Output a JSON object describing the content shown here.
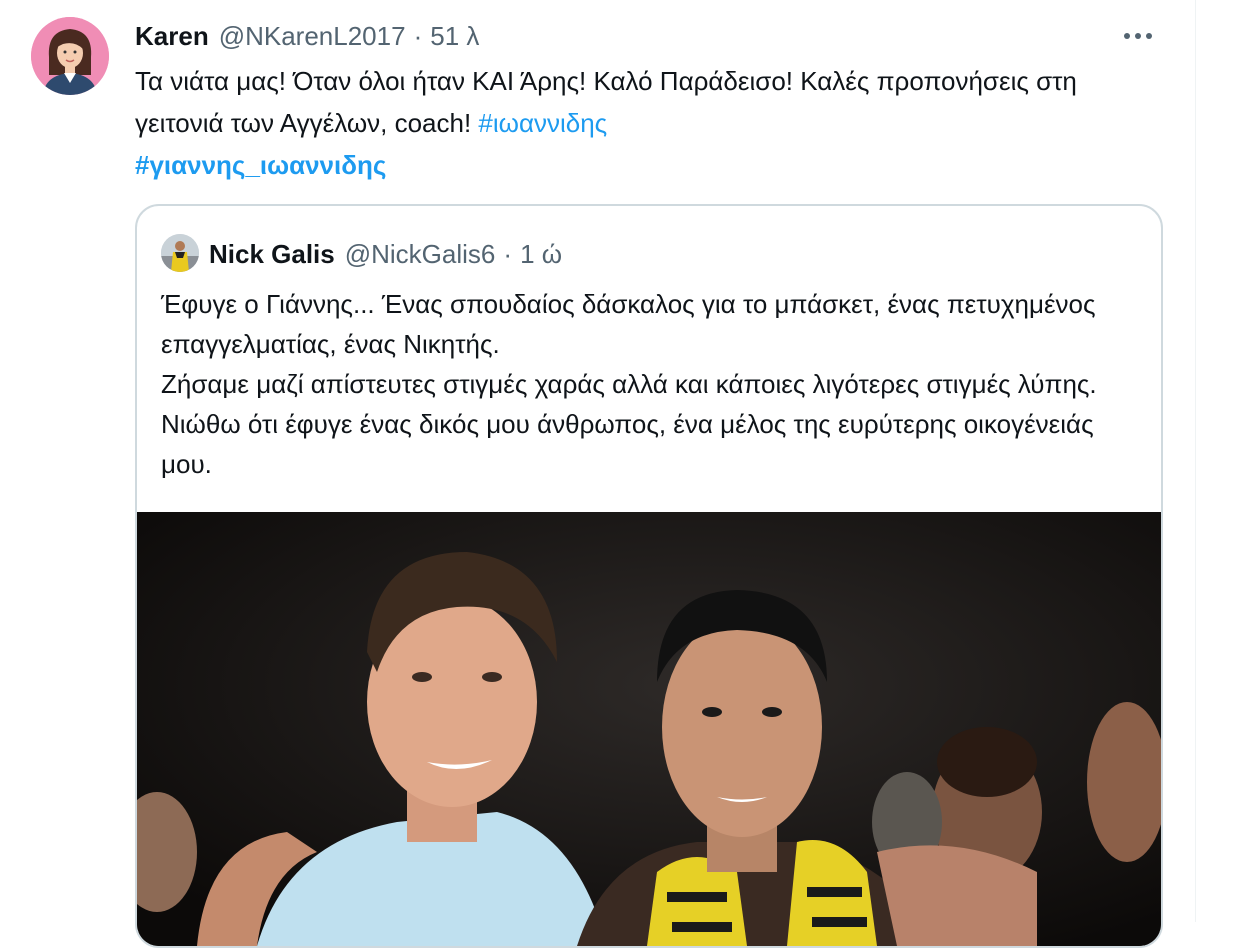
{
  "tweet": {
    "author_name": "Karen",
    "author_handle": "@NKarenL2017",
    "separator": "·",
    "timestamp": "51 λ",
    "text_main": "Τα νιάτα μας! Όταν όλοι ήταν ΚΑΙ Άρης! Καλό Παράδεισο! Καλές προπονήσεις στη γειτονιά των Αγγέλων, coach! ",
    "hashtag_1": "#ιωαννιδης",
    "hashtag_2": "#γιαννης_ιωαννιδης",
    "avatar_icon": "woman-avatar-icon",
    "more_icon": "more-dots-icon"
  },
  "quoted_tweet": {
    "author_name": "Nick Galis",
    "author_handle": "@NickGalis6",
    "separator": "·",
    "timestamp": "1 ώ",
    "text_lines": [
      "Έφυγε ο Γιάννης... Ένας σπουδαίος δάσκαλος για το μπάσκετ, ένας πετυχημένος επαγγελματίας, ένας Νικητής.",
      "Ζήσαμε μαζί απίστευτες στιγμές χαράς αλλά και κάποιες λιγότερες στιγμές λύπης. Νιώθω ότι έφυγε ένας δικός μου άνθρωπος, ένα μέλος της ευρύτερης οικογένειάς μου."
    ],
    "avatar_icon": "basketball-player-avatar-icon"
  },
  "colors": {
    "link": "#1d9bf0",
    "secondary_text": "#536471",
    "border": "#cfd9de"
  }
}
